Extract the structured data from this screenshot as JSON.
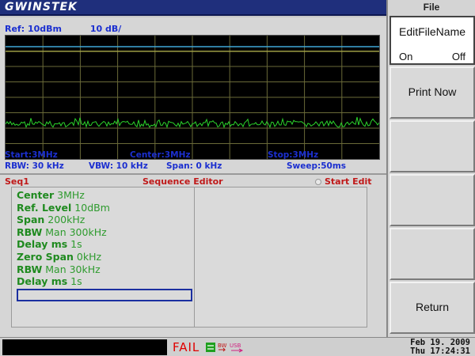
{
  "header": {
    "brand": "GWINSTEK"
  },
  "display": {
    "ref_level": "Ref: 10dBm",
    "scale": "10 dB/",
    "start": "Start:3MHz",
    "center": "Center:3MHz",
    "stop": "Stop:3MHz",
    "rbw": "RBW: 30 kHz",
    "vbw": "VBW: 10 kHz",
    "span": "Span: 0 kHz",
    "sweep": "Sweep:50ms",
    "trace_color": "#2bd42b",
    "ref_line_color": "#3fa8d8"
  },
  "sequence": {
    "name": "Seq1",
    "title": "Sequence Editor",
    "edit_label": "Start Edit",
    "items": [
      {
        "key": "Center",
        "value": "3MHz"
      },
      {
        "key": "Ref. Level",
        "value": "10dBm"
      },
      {
        "key": "Span",
        "value": "200kHz"
      },
      {
        "key": "RBW",
        "value": "Man 300kHz"
      },
      {
        "key": "Delay ms",
        "value": "1s"
      },
      {
        "key": "Zero Span",
        "value": "0kHz"
      },
      {
        "key": "RBW",
        "value": "Man 30kHz"
      },
      {
        "key": "Delay ms",
        "value": "1s"
      }
    ]
  },
  "menu": {
    "title": "File",
    "editfilename_label": "EditFileName",
    "editfilename_on": "On",
    "editfilename_off": "Off",
    "print_now": "Print Now",
    "return": "Return"
  },
  "status": {
    "fail": "FAIL",
    "date": "Feb 19. 2009",
    "time": "Thu 17:24:31",
    "icons": [
      "network-icon",
      "bw-usb-icon",
      "usb-icon"
    ]
  }
}
